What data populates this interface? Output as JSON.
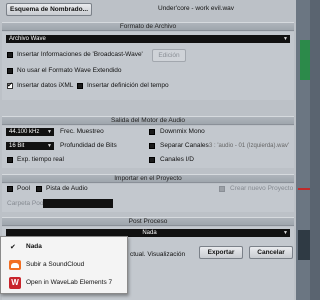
{
  "window": {
    "naming_scheme_button": "Esquema de Nombrado...",
    "filename": "Under'core - work evil.wav"
  },
  "file_format": {
    "section_title": "Formato de Archivo",
    "format_value": "Archivo Wave",
    "bwf_label": "Insertar Informaciones de 'Broadcast-Wave'",
    "edit_button": "Edición",
    "no_extended_label": "No usar el Formato Wave Extendido",
    "ixml_label": "Insertar datos iXML",
    "tempo_label": "Insertar definición del tempo"
  },
  "audio_engine": {
    "section_title": "Salida del Motor de Audio",
    "sample_rate_value": "44.100 kHz",
    "sample_rate_label": "Frec. Muestreo",
    "bit_depth_value": "16 Bit",
    "bit_depth_label": "Profundidad de Bits",
    "realtime_label": "Exp. tiempo real",
    "downmix_label": "Downmix Mono",
    "split_label": "Separar Canales",
    "split_hint": "3 : 'audio - 01 (Izquierda).wav'",
    "lr_label": "Canales I/D"
  },
  "import": {
    "section_title": "Importar en el Proyecto",
    "pool_label": "Pool",
    "audio_track_label": "Pista de Audio",
    "new_project_label": "Crear nuevo Proyecto",
    "pool_folder_label": "Carpeta Pool"
  },
  "post": {
    "section_title": "Post Proceso",
    "value": "Nada",
    "update_label": "ctual. Visualización",
    "export_button": "Exportar",
    "cancel_button": "Cancelar"
  },
  "menu": {
    "items": [
      {
        "label": "Nada",
        "checked": true
      },
      {
        "label": "Subir a SoundCloud",
        "icon": "soundcloud-icon"
      },
      {
        "label": "Open in WaveLab Elements 7",
        "icon": "wavelab-icon"
      }
    ]
  },
  "colors": {
    "dialog_bg": "#bcc1c7",
    "header_bg": "#a6adb4",
    "field_bg": "#111111",
    "soundcloud": "#f26f23",
    "wavelab": "#c8242b"
  }
}
